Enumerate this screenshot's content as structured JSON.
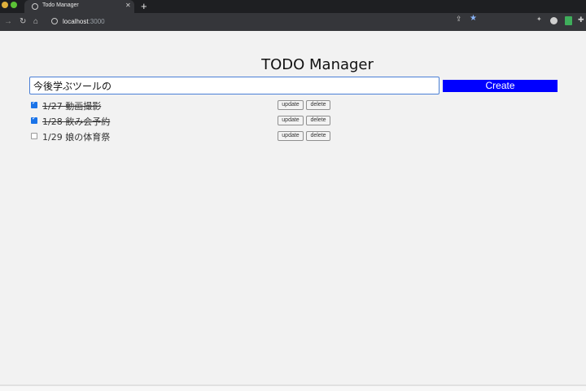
{
  "browser": {
    "tab_title": "Todo Manager",
    "tab_close": "✕",
    "new_tab": "+",
    "url_host": "localhost",
    "url_port": ":3000"
  },
  "icons": {
    "back": "back-arrow-icon",
    "reload": "reload-icon",
    "home": "home-icon",
    "info": "info-icon",
    "share": "share-icon",
    "bookmark": "star-icon",
    "extensions": "puzzle-icon"
  },
  "colors": {
    "create_button": "#0000ff",
    "input_border": "#4a7fd6",
    "checkbox": "#1a73e8"
  },
  "app": {
    "title": "TODO Manager",
    "input_value": "今後学ぶツールの",
    "create_label": "Create",
    "update_label": "update",
    "delete_label": "delete",
    "todos": [
      {
        "text": "1/27 動画撮影",
        "done": true
      },
      {
        "text": "1/28 飲み会予約",
        "done": true
      },
      {
        "text": "1/29 娘の体育祭",
        "done": false
      }
    ]
  }
}
